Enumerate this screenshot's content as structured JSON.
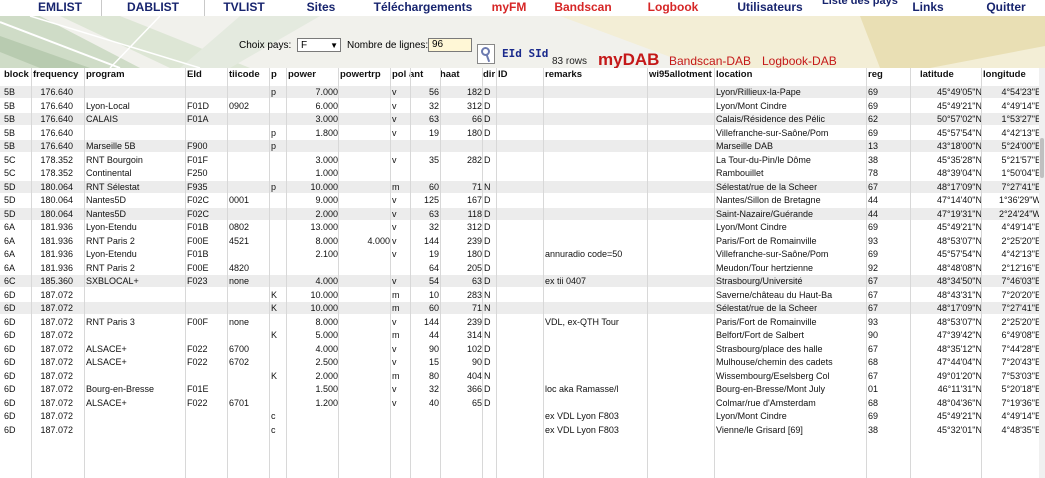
{
  "nav": {
    "tabs": [
      {
        "label": "EMLIST",
        "color": "blue",
        "active": false
      },
      {
        "label": "DABLIST",
        "color": "blue",
        "active": true
      },
      {
        "label": "TVLIST",
        "color": "blue",
        "active": false
      },
      {
        "label": "Sites",
        "color": "blue",
        "active": false
      },
      {
        "label": "Téléchargements",
        "color": "blue",
        "active": false
      },
      {
        "label": "myFM",
        "color": "red",
        "active": false
      },
      {
        "label": "Bandscan",
        "color": "red",
        "active": false
      },
      {
        "label": "Logbook",
        "color": "red",
        "active": false
      },
      {
        "label": "Utilisateurs",
        "color": "blue",
        "active": false
      },
      {
        "label": "Liste des pays",
        "color": "blue",
        "active": false
      },
      {
        "label": "Links",
        "color": "blue",
        "active": false
      },
      {
        "label": "Quitter",
        "color": "blue",
        "active": false
      }
    ]
  },
  "toolbar": {
    "country_label": "Choix pays:",
    "country_value": "F",
    "lines_label": "Nombre de lignes:",
    "lines_value": "96",
    "eid_sid": "EId SId",
    "rows_info": "83 rows",
    "mydab": "myDAB",
    "bandscan_link": "Bandscan-DAB",
    "logbook_link": "Logbook-DAB"
  },
  "table": {
    "headers": [
      "block",
      "frequency",
      "program",
      "EId",
      "tiicode",
      "p",
      "power",
      "powertrp",
      "pol",
      "ant",
      "haat",
      "dir",
      "ID",
      "remarks",
      "wi95allotment",
      "location",
      "reg",
      "latitude",
      "longitude"
    ],
    "rows": [
      [
        "5B",
        "176.640",
        "",
        "",
        "",
        "p",
        "7.000",
        "",
        "v",
        "56",
        "182",
        "D",
        "",
        "",
        "",
        "Lyon/Rillieux-la-Pape",
        "69",
        "45°49'05\"N",
        "4°54'23\"E"
      ],
      [
        "5B",
        "176.640",
        "Lyon-Local",
        "F01D",
        "0902",
        "",
        "6.000",
        "",
        "v",
        "32",
        "312",
        "D",
        "",
        "",
        "",
        "Lyon/Mont Cindre",
        "69",
        "45°49'21\"N",
        "4°49'14\"E"
      ],
      [
        "5B",
        "176.640",
        "CALAIS",
        "F01A",
        "",
        "",
        "3.000",
        "",
        "v",
        "63",
        "66",
        "D",
        "",
        "",
        "",
        "Calais/Résidence des Pélic",
        "62",
        "50°57'02\"N",
        "1°53'27\"E"
      ],
      [
        "5B",
        "176.640",
        "",
        "",
        "",
        "p",
        "1.800",
        "",
        "v",
        "19",
        "180",
        "D",
        "",
        "",
        "",
        "Villefranche-sur-Saône/Pom",
        "69",
        "45°57'54\"N",
        "4°42'13\"E"
      ],
      [
        "5B",
        "176.640",
        "Marseille 5B",
        "F900",
        "",
        "p",
        "",
        "",
        "",
        "",
        "",
        "",
        "",
        "",
        "",
        "Marseille DAB",
        "13",
        "43°18'00\"N",
        "5°24'00\"E"
      ],
      [
        "5C",
        "178.352",
        "RNT Bourgoin",
        "F01F",
        "",
        "",
        "3.000",
        "",
        "v",
        "35",
        "282",
        "D",
        "",
        "",
        "",
        "La Tour-du-Pin/le Dôme",
        "38",
        "45°35'28\"N",
        "5°21'57\"E"
      ],
      [
        "5C",
        "178.352",
        "Continental",
        "F250",
        "",
        "",
        "1.000",
        "",
        "",
        "",
        "",
        "",
        "",
        "",
        "",
        "Rambouillet",
        "78",
        "48°39'04\"N",
        "1°50'04\"E"
      ],
      [
        "5D",
        "180.064",
        "RNT Sélestat",
        "F935",
        "",
        "p",
        "10.000",
        "",
        "m",
        "60",
        "71",
        "N",
        "",
        "",
        "",
        "Sélestat/rue de la Scheer",
        "67",
        "48°17'09\"N",
        "7°27'41\"E"
      ],
      [
        "5D",
        "180.064",
        "Nantes5D",
        "F02C",
        "0001",
        "",
        "9.000",
        "",
        "v",
        "125",
        "167",
        "D",
        "",
        "",
        "",
        "Nantes/Sillon de Bretagne",
        "44",
        "47°14'40\"N",
        "1°36'29\"W"
      ],
      [
        "5D",
        "180.064",
        "Nantes5D",
        "F02C",
        "",
        "",
        "2.000",
        "",
        "v",
        "63",
        "118",
        "D",
        "",
        "",
        "",
        "Saint-Nazaire/Guérande",
        "44",
        "47°19'31\"N",
        "2°24'24\"W"
      ],
      [
        "6A",
        "181.936",
        "Lyon-Etendu",
        "F01B",
        "0802",
        "",
        "13.000",
        "",
        "v",
        "32",
        "312",
        "D",
        "",
        "",
        "",
        "Lyon/Mont Cindre",
        "69",
        "45°49'21\"N",
        "4°49'14\"E"
      ],
      [
        "6A",
        "181.936",
        "RNT Paris 2",
        "F00E",
        "4521",
        "",
        "8.000",
        "4.000",
        "v",
        "144",
        "239",
        "D",
        "",
        "",
        "",
        "Paris/Fort de Romainville",
        "93",
        "48°53'07\"N",
        "2°25'20\"E"
      ],
      [
        "6A",
        "181.936",
        "Lyon-Etendu",
        "F01B",
        "",
        "",
        "2.100",
        "",
        "v",
        "19",
        "180",
        "D",
        "",
        "annuradio code=50",
        "",
        "Villefranche-sur-Saône/Pom",
        "69",
        "45°57'54\"N",
        "4°42'13\"E"
      ],
      [
        "6A",
        "181.936",
        "RNT Paris 2",
        "F00E",
        "4820",
        "",
        "",
        "",
        "",
        "64",
        "205",
        "D",
        "",
        "",
        "",
        "Meudon/Tour hertzienne",
        "92",
        "48°48'08\"N",
        "2°12'16\"E"
      ],
      [
        "6C",
        "185.360",
        "SXBLOCAL+",
        "F023",
        "none",
        "",
        "4.000",
        "",
        "v",
        "54",
        "63",
        "D",
        "",
        "ex tii 0407",
        "",
        "Strasbourg/Université",
        "67",
        "48°34'50\"N",
        "7°46'03\"E"
      ],
      [
        "6D",
        "187.072",
        "",
        "",
        "",
        "K",
        "10.000",
        "",
        "m",
        "10",
        "283",
        "N",
        "",
        "",
        "",
        "Saverne/château du Haut-Ba",
        "67",
        "48°43'31\"N",
        "7°20'20\"E"
      ],
      [
        "6D",
        "187.072",
        "",
        "",
        "",
        "K",
        "10.000",
        "",
        "m",
        "60",
        "71",
        "N",
        "",
        "",
        "",
        "Sélestat/rue de la Scheer",
        "67",
        "48°17'09\"N",
        "7°27'41\"E"
      ],
      [
        "6D",
        "187.072",
        "RNT Paris 3",
        "F00F",
        "none",
        "",
        "8.000",
        "",
        "v",
        "144",
        "239",
        "D",
        "",
        "VDL, ex-QTH Tour",
        "",
        "Paris/Fort de Romainville",
        "93",
        "48°53'07\"N",
        "2°25'20\"E"
      ],
      [
        "6D",
        "187.072",
        "",
        "",
        "",
        "K",
        "5.000",
        "",
        "m",
        "44",
        "314",
        "N",
        "",
        "",
        "",
        "Belfort/Fort de Salbert",
        "90",
        "47°39'42\"N",
        "6°49'08\"E"
      ],
      [
        "6D",
        "187.072",
        "ALSACE+",
        "F022",
        "6700",
        "",
        "4.000",
        "",
        "v",
        "90",
        "102",
        "D",
        "",
        "",
        "",
        "Strasbourg/place des halle",
        "67",
        "48°35'12\"N",
        "7°44'28\"E"
      ],
      [
        "6D",
        "187.072",
        "ALSACE+",
        "F022",
        "6702",
        "",
        "2.500",
        "",
        "v",
        "15",
        "90",
        "D",
        "",
        "",
        "",
        "Mulhouse/chemin des cadets",
        "68",
        "47°44'04\"N",
        "7°20'43\"E"
      ],
      [
        "6D",
        "187.072",
        "",
        "",
        "",
        "K",
        "2.000",
        "",
        "m",
        "80",
        "404",
        "N",
        "",
        "",
        "",
        "Wissembourg/Eselsberg Col",
        "67",
        "49°01'20\"N",
        "7°53'03\"E"
      ],
      [
        "6D",
        "187.072",
        "Bourg-en-Bresse",
        "F01E",
        "",
        "",
        "1.500",
        "",
        "v",
        "32",
        "366",
        "D",
        "",
        "loc aka Ramasse/l",
        "",
        "Bourg-en-Bresse/Mont July",
        "01",
        "46°11'31\"N",
        "5°20'18\"E"
      ],
      [
        "6D",
        "187.072",
        "ALSACE+",
        "F022",
        "6701",
        "",
        "1.200",
        "",
        "v",
        "40",
        "65",
        "D",
        "",
        "",
        "",
        "Colmar/rue d'Amsterdam",
        "68",
        "48°04'36\"N",
        "7°19'36\"E"
      ],
      [
        "6D",
        "187.072",
        "",
        "",
        "",
        "c",
        "",
        "",
        "",
        "",
        "",
        "",
        "",
        "ex VDL Lyon F803",
        "",
        "Lyon/Mont Cindre",
        "69",
        "45°49'21\"N",
        "4°49'14\"E"
      ],
      [
        "6D",
        "187.072",
        "",
        "",
        "",
        "c",
        "",
        "",
        "",
        "",
        "",
        "",
        "",
        "ex VDL Lyon F803",
        "",
        "Vienne/le Grisard [69]",
        "38",
        "45°32'01\"N",
        "4°48'35\"E"
      ]
    ],
    "alt_rows": [
      0,
      2,
      4,
      7,
      9,
      14,
      16
    ]
  }
}
